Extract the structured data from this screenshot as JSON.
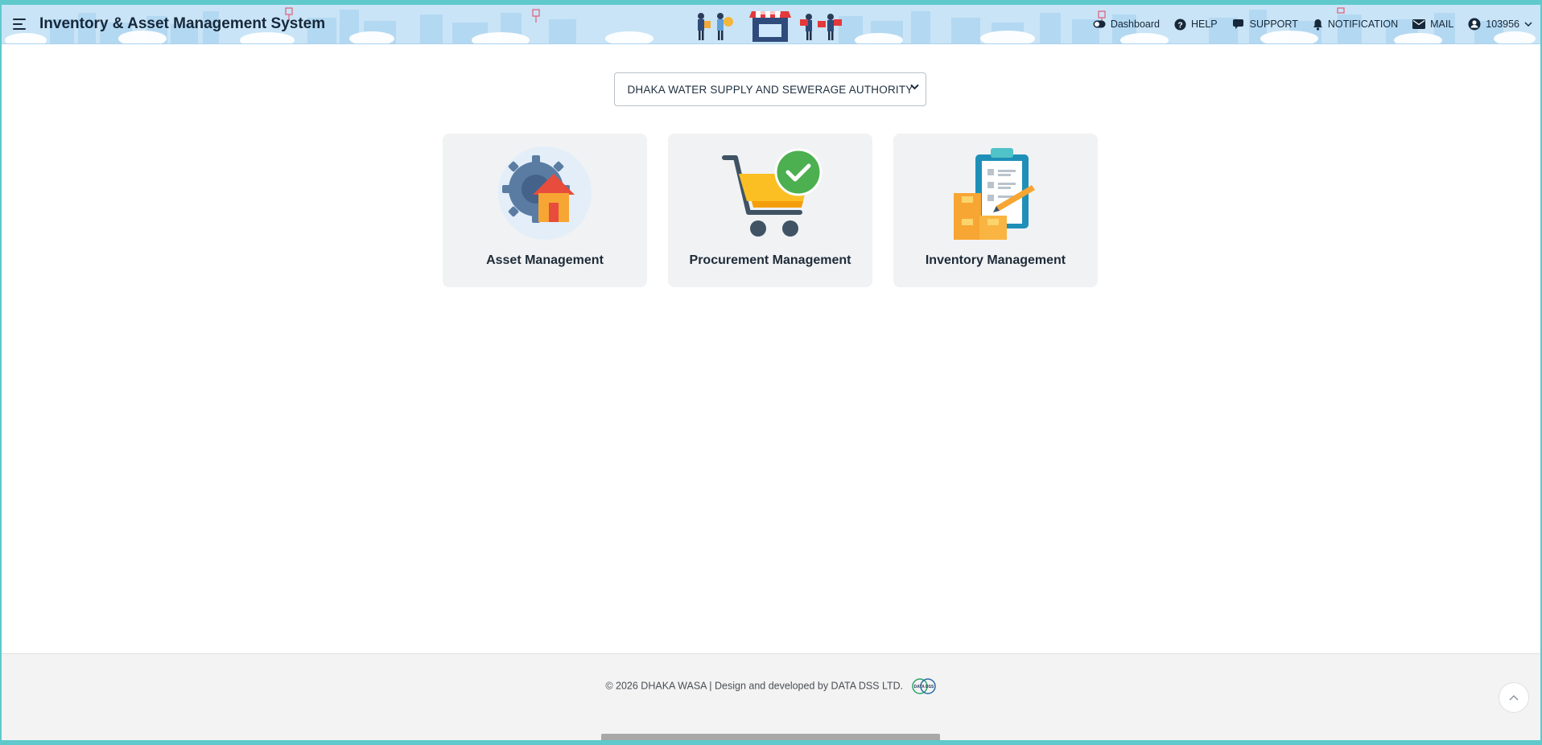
{
  "app": {
    "title": "Inventory & Asset Management System"
  },
  "nav": {
    "dashboard": "Dashboard",
    "help": "HELP",
    "support": "SUPPORT",
    "notification": "NOTIFICATION",
    "mail": "MAIL",
    "user": "103956"
  },
  "organization": {
    "selected": "DHAKA WATER SUPPLY AND SEWERAGE AUTHORITY"
  },
  "modules": [
    {
      "label": "Asset Management",
      "icon": "asset-management-icon"
    },
    {
      "label": "Procurement Management",
      "icon": "procurement-cart-icon"
    },
    {
      "label": "Inventory Management",
      "icon": "inventory-clipboard-icon"
    }
  ],
  "footer": {
    "copyright": "© 2026 DHAKA WASA | Design and developed by DATA DSS LTD.",
    "logo_text": "DATA DSS"
  },
  "colors": {
    "header_bg": "#c9e4f6",
    "border_teal": "#5fc9cc",
    "card_bg": "#f1f2f4",
    "success_green": "#4caf50",
    "cart_yellow": "#fbbf24"
  }
}
